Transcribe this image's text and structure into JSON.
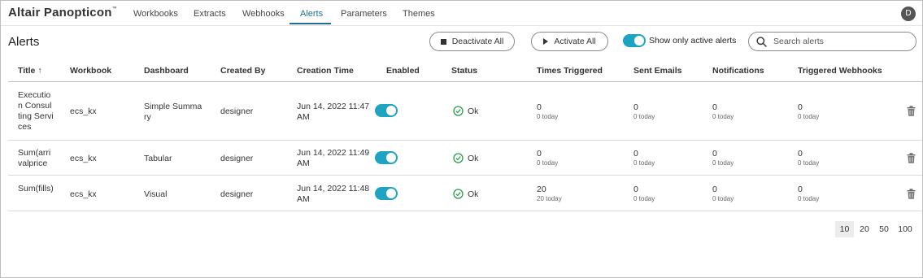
{
  "app": {
    "brand": "Altair Panopticon",
    "trademark": "™",
    "user_initial": "D"
  },
  "nav": {
    "tabs": [
      {
        "label": "Workbooks"
      },
      {
        "label": "Extracts"
      },
      {
        "label": "Webhooks"
      },
      {
        "label": "Alerts",
        "active": true
      },
      {
        "label": "Parameters"
      },
      {
        "label": "Themes"
      }
    ]
  },
  "page": {
    "title": "Alerts"
  },
  "toolbar": {
    "deactivate_label": "Deactivate All",
    "activate_label": "Activate All",
    "active_only_label": "Show only active alerts",
    "active_only": true,
    "search_placeholder": "Search alerts"
  },
  "table": {
    "columns": [
      {
        "label": "Title",
        "sort": "↑"
      },
      {
        "label": "Workbook"
      },
      {
        "label": "Dashboard"
      },
      {
        "label": "Created By"
      },
      {
        "label": "Creation Time"
      },
      {
        "label": "Enabled"
      },
      {
        "label": "Status"
      },
      {
        "label": "Times Triggered"
      },
      {
        "label": "Sent Emails"
      },
      {
        "label": "Notifications"
      },
      {
        "label": "Triggered Webhooks"
      }
    ],
    "rows": [
      {
        "title": "Execution Consulting Services",
        "workbook": "ecs_kx",
        "dashboard": "Simple Summary",
        "created_by": "designer",
        "creation_time": "Jun 14, 2022 11:47 AM",
        "enabled": true,
        "status": "Ok",
        "times_triggered": "0",
        "times_triggered_today": "0 today",
        "sent_emails": "0",
        "sent_emails_today": "0 today",
        "notifications": "0",
        "notifications_today": "0 today",
        "webhooks": "0",
        "webhooks_today": "0 today"
      },
      {
        "title": "Sum(arrivalprice",
        "workbook": "ecs_kx",
        "dashboard": "Tabular",
        "created_by": "designer",
        "creation_time": "Jun 14, 2022 11:49 AM",
        "enabled": true,
        "status": "Ok",
        "times_triggered": "0",
        "times_triggered_today": "0 today",
        "sent_emails": "0",
        "sent_emails_today": "0 today",
        "notifications": "0",
        "notifications_today": "0 today",
        "webhooks": "0",
        "webhooks_today": "0 today"
      },
      {
        "title": "Sum(fills)",
        "workbook": "ecs_kx",
        "dashboard": "Visual",
        "created_by": "designer",
        "creation_time": "Jun 14, 2022 11:48 AM",
        "enabled": true,
        "status": "Ok",
        "times_triggered": "20",
        "times_triggered_today": "20 today",
        "sent_emails": "0",
        "sent_emails_today": "0 today",
        "notifications": "0",
        "notifications_today": "0 today",
        "webhooks": "0",
        "webhooks_today": "0 today"
      }
    ]
  },
  "pagination": {
    "sizes": [
      "10",
      "20",
      "50",
      "100"
    ],
    "selected": "10"
  },
  "colors": {
    "accent": "#1fa3c0",
    "nav_active": "#1f6e95",
    "ok_green": "#2e9e4f"
  }
}
